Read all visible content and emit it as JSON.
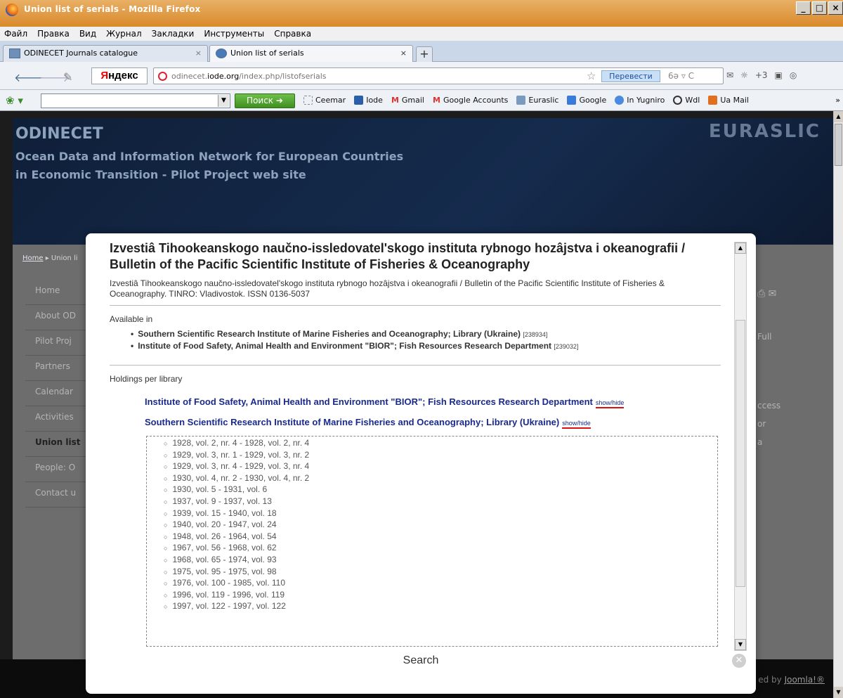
{
  "window": {
    "title": "Union list of serials - Mozilla Firefox"
  },
  "menu": [
    "Файл",
    "Правка",
    "Вид",
    "Журнал",
    "Закладки",
    "Инструменты",
    "Справка"
  ],
  "tabs": [
    {
      "label": "ODINECET Journals catalogue"
    },
    {
      "label": "Union list of serials"
    }
  ],
  "nav": {
    "yandex": {
      "prefix": "Я",
      "rest": "ндекс"
    },
    "url_prefix": "odinecet.",
    "url_domain": "iode.org",
    "url_path": "/index.php/listofserials",
    "translate": "Перевести",
    "extras": "+3"
  },
  "search": {
    "button": "Поиск"
  },
  "bookmarks": [
    {
      "label": "Ceemar",
      "color": "#ffffff"
    },
    {
      "label": "Iode",
      "color": "#2a5ea8"
    },
    {
      "label": "Gmail",
      "color": "#d33"
    },
    {
      "label": "Google Accounts",
      "color": "#d33"
    },
    {
      "label": "Euraslic",
      "color": "#7a9ac0"
    },
    {
      "label": "Google",
      "color": "#3a7ad8"
    },
    {
      "label": "In Yugniro",
      "color": "#4a8ae0"
    },
    {
      "label": "Wdl",
      "color": "#333"
    },
    {
      "label": "Ua Mail",
      "color": "#e07020"
    }
  ],
  "site": {
    "brand": "ODINECET",
    "subtitle_1": "Ocean Data and Information Network for European Countries",
    "subtitle_2": "in Economic Transition - Pilot Project web site",
    "logo": "EURASLIC",
    "breadcrumb_home": "Home",
    "breadcrumb_rest": "Union li",
    "menu": [
      "Home",
      "About OD",
      "Pilot Proj",
      "Partners",
      "Calendar",
      "Activities",
      "Union list",
      "People: O",
      "Contact u"
    ],
    "right_text": [
      "Full",
      "ccess",
      "or",
      "a"
    ],
    "footer": "ed by ",
    "footer_link": "Joomla!®"
  },
  "modal": {
    "title": "Izvestiâ Tihookeanskogo naučno-issledovatel'skogo instituta rybnogo hozâjstva i okeanografii / Bulletin of the Pacific Scientific Institute of Fisheries & Oceanography",
    "description": "Izvestiâ Tihookeanskogo naučno-issledovatel'skogo instituta rybnogo hozâjstva i okeanografii / Bulletin of the Pacific Scientific Institute of Fisheries & Oceanography. TINRO: Vladivostok. ISSN 0136-5037",
    "available_label": "Available in",
    "available": [
      {
        "name": "Southern Scientific Research Institute of Marine Fisheries and Oceanography; Library (Ukraine)",
        "id": "[238934]"
      },
      {
        "name": "Institute of Food Safety, Animal Health and Environment \"BIOR\"; Fish Resources Research Department",
        "id": "[239032]"
      }
    ],
    "holdings_label": "Holdings per library",
    "libraries": [
      {
        "name": "Institute of Food Safety, Animal Health and Environment \"BIOR\"; Fish Resources Research Department",
        "toggle": "show/hide"
      },
      {
        "name": "Southern Scientific Research Institute of Marine Fisheries and Oceanography; Library (Ukraine)",
        "toggle": "show/hide"
      }
    ],
    "holdings": [
      "1928, vol. 2, nr. 4 - 1928, vol. 2, nr. 4",
      "1929, vol. 3, nr. 1 - 1929, vol. 3, nr. 2",
      "1929, vol. 3, nr. 4 - 1929, vol. 3, nr. 4",
      "1930, vol. 4, nr. 2 - 1930, vol. 4, nr. 2",
      "1930, vol. 5 - 1931, vol. 6",
      "1937, vol. 9 - 1937, vol. 13",
      "1939, vol. 15 - 1940, vol. 18",
      "1940, vol. 20 - 1947, vol. 24",
      "1948, vol. 26 - 1964, vol. 54",
      "1967, vol. 56 - 1968, vol. 62",
      "1968, vol. 65 - 1974, vol. 93",
      "1975, vol. 95 - 1975, vol. 98",
      "1976, vol. 100 - 1985, vol. 110",
      "1996, vol. 119 - 1996, vol. 119",
      "1997, vol. 122 - 1997, vol. 122"
    ],
    "footer_title": "Search"
  }
}
